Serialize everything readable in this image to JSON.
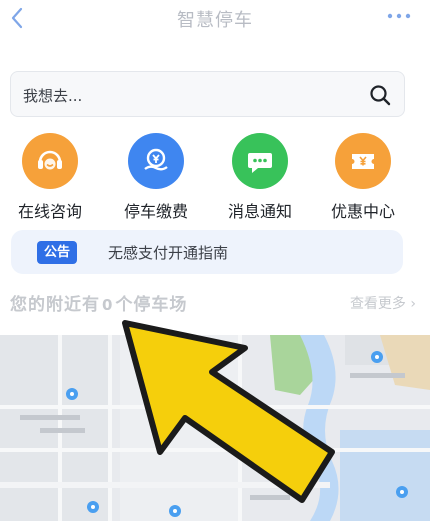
{
  "header": {
    "title": "智慧停车"
  },
  "search": {
    "placeholder": "我想去..."
  },
  "quick_actions": [
    {
      "label": "在线咨询",
      "color": "#f6a13a",
      "icon": "headset-icon"
    },
    {
      "label": "停车缴费",
      "color": "#3f86f0",
      "icon": "wallet-icon"
    },
    {
      "label": "消息通知",
      "color": "#38c25a",
      "icon": "chat-bubble-icon"
    },
    {
      "label": "优惠中心",
      "color": "#f6a13a",
      "icon": "ticket-icon"
    }
  ],
  "notice": {
    "badge": "公告",
    "text": "无感支付开通指南"
  },
  "nearby": {
    "prefix": "您的附近有",
    "count": "0",
    "suffix": "个停车场",
    "see_more": "查看更多"
  },
  "colors": {
    "accent": "#2f6fe6",
    "arrow_fill": "#f5cf0c"
  }
}
